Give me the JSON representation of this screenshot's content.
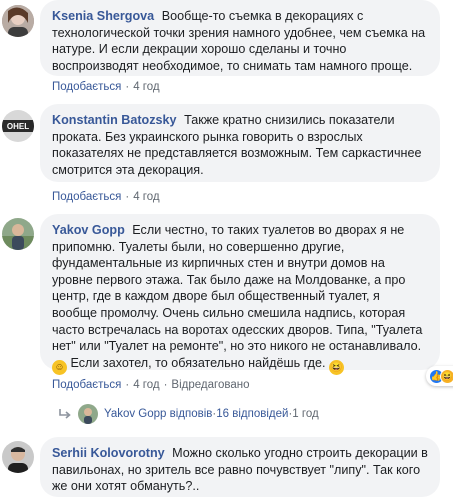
{
  "comments": [
    {
      "author": "Ksenia Shergova",
      "text": "Вообще-то съемка в декорациях с технологической точки зрения намного удобнее, чем съемка на натуре. И если декрации хорошо сделаны и точно воспроизводят необходимое, то снимать там намного проще.",
      "like_label": "Подобається",
      "time": "4 год"
    },
    {
      "author": "Konstantin Batozsky",
      "text": "Также кратно снизились показатели проката. Без украинского рынка говорить о взрослых показателях не представляется возможным. Тем саркастичнее смотрится эта декорация.",
      "like_label": "Подобається",
      "time": "4 год"
    },
    {
      "author": "Yakov Gopp",
      "text_a": "Если честно, то таких туалетов во дворах я не припомню. Туалеты были, но совершенно другие, фундаментальные из кирпичных стен и внутри домов на уровне первого этажа. Так было даже на Молдованке, а про центр, где в каждом дворе был общественный туалет, я вообще промолчу. Очень сильно смешила надпись, которая часто встречалась на воротах одесских дворов. Типа, \"Туалета нет\" или \"Туалет на ремонте\", но это никого не останавливало.",
      "text_b": "Если захотел, то обязательно найдёшь где.",
      "like_label": "Подобається",
      "time": "4 год",
      "edited_label": "Відредаговано",
      "reactions_count": "2"
    },
    {
      "author": "Serhii Kolovorotny",
      "text": "Можно сколько угодно строить декорации в павильонах, но зритель все равно почувствует \"липу\". Так кого же они хотят обмануть?.."
    }
  ],
  "reply_summary": {
    "author": "Yakov Gopp",
    "replied_label": "відповів",
    "replies_count": "16 відповідей",
    "time": "1 год"
  },
  "colors": {
    "link": "#385898",
    "bubble": "#f2f3f5",
    "like": "#2078f4",
    "haha": "#f7b125"
  },
  "icons": [
    "like-reaction-icon",
    "haha-reaction-icon",
    "reply-arrow-icon"
  ]
}
